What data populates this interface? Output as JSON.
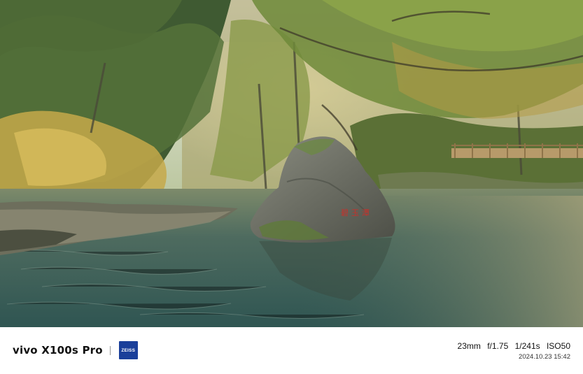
{
  "photo": {
    "rock_inscription": "碧玉潭"
  },
  "footer": {
    "brand": "vivo X100s Pro",
    "logo_text": "ZEISS",
    "focal_length": "23mm",
    "aperture": "f/1.75",
    "shutter": "1/241s",
    "iso": "ISO50",
    "datetime": "2024.10.23 15:42"
  }
}
